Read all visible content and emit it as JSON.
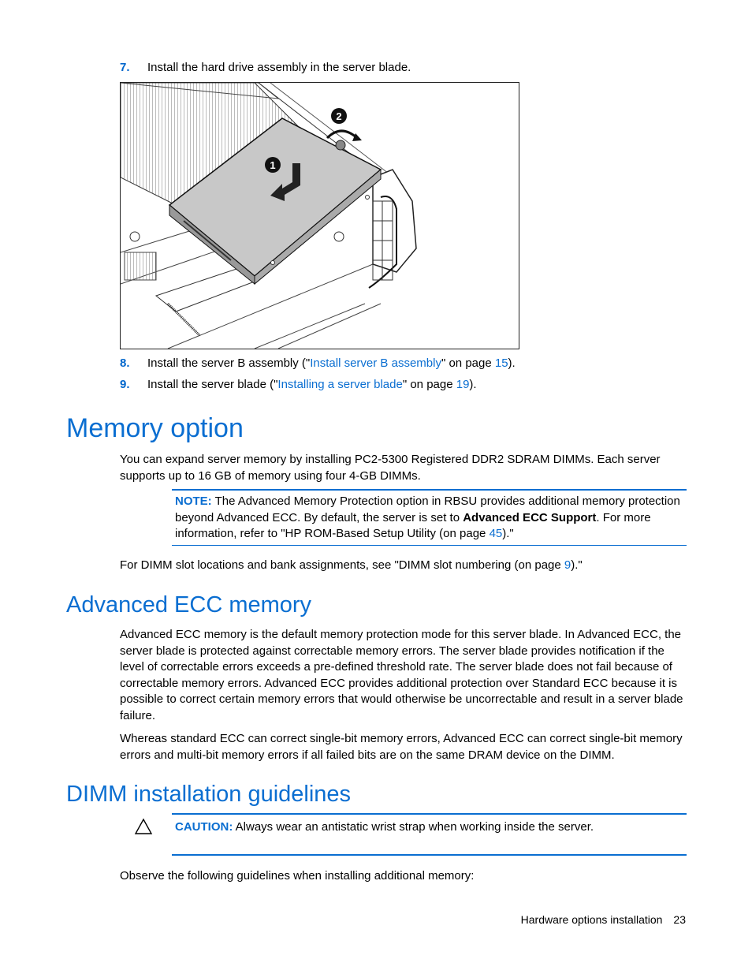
{
  "steps": [
    {
      "number": "7.",
      "text": "Install the hard drive assembly in the server blade."
    },
    {
      "number": "8.",
      "prefix": "Install the server B assembly (\"",
      "link": "Install server B assembly",
      "middle": "\" on page ",
      "page": "15",
      "suffix": ")."
    },
    {
      "number": "9.",
      "prefix": "Install the server blade (\"",
      "link": "Installing a server blade",
      "middle": "\" on page ",
      "page": "19",
      "suffix": ")."
    }
  ],
  "figure": {
    "description": "Hard drive assembly being installed into server blade",
    "callouts": [
      "1",
      "2"
    ]
  },
  "memory_option": {
    "heading": "Memory option",
    "intro": "You can expand server memory by installing PC2-5300 Registered DDR2 SDRAM DIMMs. Each server supports up to 16 GB of memory using four 4-GB DIMMs.",
    "note": {
      "label": "NOTE:",
      "text_before_bold": " The Advanced Memory Protection option in RBSU provides additional memory protection beyond Advanced ECC. By default, the server is set to ",
      "bold": "Advanced ECC Support",
      "text_after_bold": ". For more information, refer to \"HP ROM-Based Setup Utility (on page ",
      "page": "45",
      "end": ").\""
    },
    "dimm_ref_before": "For DIMM slot locations and bank assignments, see \"DIMM slot numbering (on page ",
    "dimm_ref_page": "9",
    "dimm_ref_after": ").\""
  },
  "advanced_ecc": {
    "heading": "Advanced ECC memory",
    "para1": "Advanced ECC memory is the default memory protection mode for this server blade. In Advanced ECC, the server blade is protected against correctable memory errors. The server blade provides notification if the level of correctable errors exceeds a pre-defined threshold rate. The server blade does not fail because of correctable memory errors. Advanced ECC provides additional protection over Standard ECC because it is possible to correct certain memory errors that would otherwise be uncorrectable and result in a server blade failure.",
    "para2": "Whereas standard ECC can correct single-bit memory errors, Advanced ECC can correct single-bit memory errors and multi-bit memory errors if all failed bits are on the same DRAM device on the DIMM."
  },
  "dimm_guidelines": {
    "heading": "DIMM installation guidelines",
    "caution_label": "CAUTION:",
    "caution_text": " Always wear an antistatic wrist strap when working inside the server.",
    "observe": "Observe the following guidelines when installing additional memory:"
  },
  "footer": {
    "section": "Hardware options installation",
    "page": "23"
  }
}
